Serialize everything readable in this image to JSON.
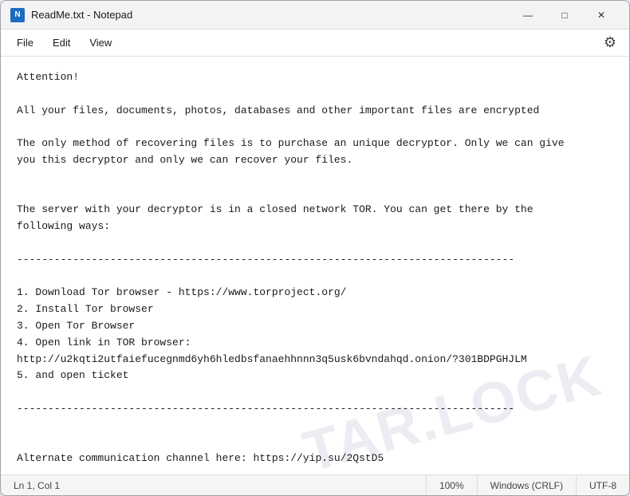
{
  "window": {
    "title": "ReadMe.txt - Notepad",
    "icon_label": "N"
  },
  "title_controls": {
    "minimize": "—",
    "maximize": "□",
    "close": "✕"
  },
  "menu": {
    "file": "File",
    "edit": "Edit",
    "view": "View",
    "settings_icon": "⚙"
  },
  "content": {
    "text": "Attention!\n\nAll your files, documents, photos, databases and other important files are encrypted\n\nThe only method of recovering files is to purchase an unique decryptor. Only we can give\nyou this decryptor and only we can recover your files.\n\n\nThe server with your decryptor is in a closed network TOR. You can get there by the\nfollowing ways:\n\n--------------------------------------------------------------------------------\n\n1. Download Tor browser - https://www.torproject.org/\n2. Install Tor browser\n3. Open Tor Browser\n4. Open link in TOR browser:\nhttp://u2kqti2utfaiefucegnmd6yh6hledbsfanaehhnnn3q5usk6bvndahqd.onion/?301BDPGHJLM\n5. and open ticket\n\n--------------------------------------------------------------------------------\n\n\nAlternate communication channel here: https://yip.su/2QstD5"
  },
  "watermark": {
    "line1": "TAR.LOCK"
  },
  "status_bar": {
    "position": "Ln 1, Col 1",
    "zoom": "100%",
    "line_ending": "Windows (CRLF)",
    "encoding": "UTF-8"
  }
}
